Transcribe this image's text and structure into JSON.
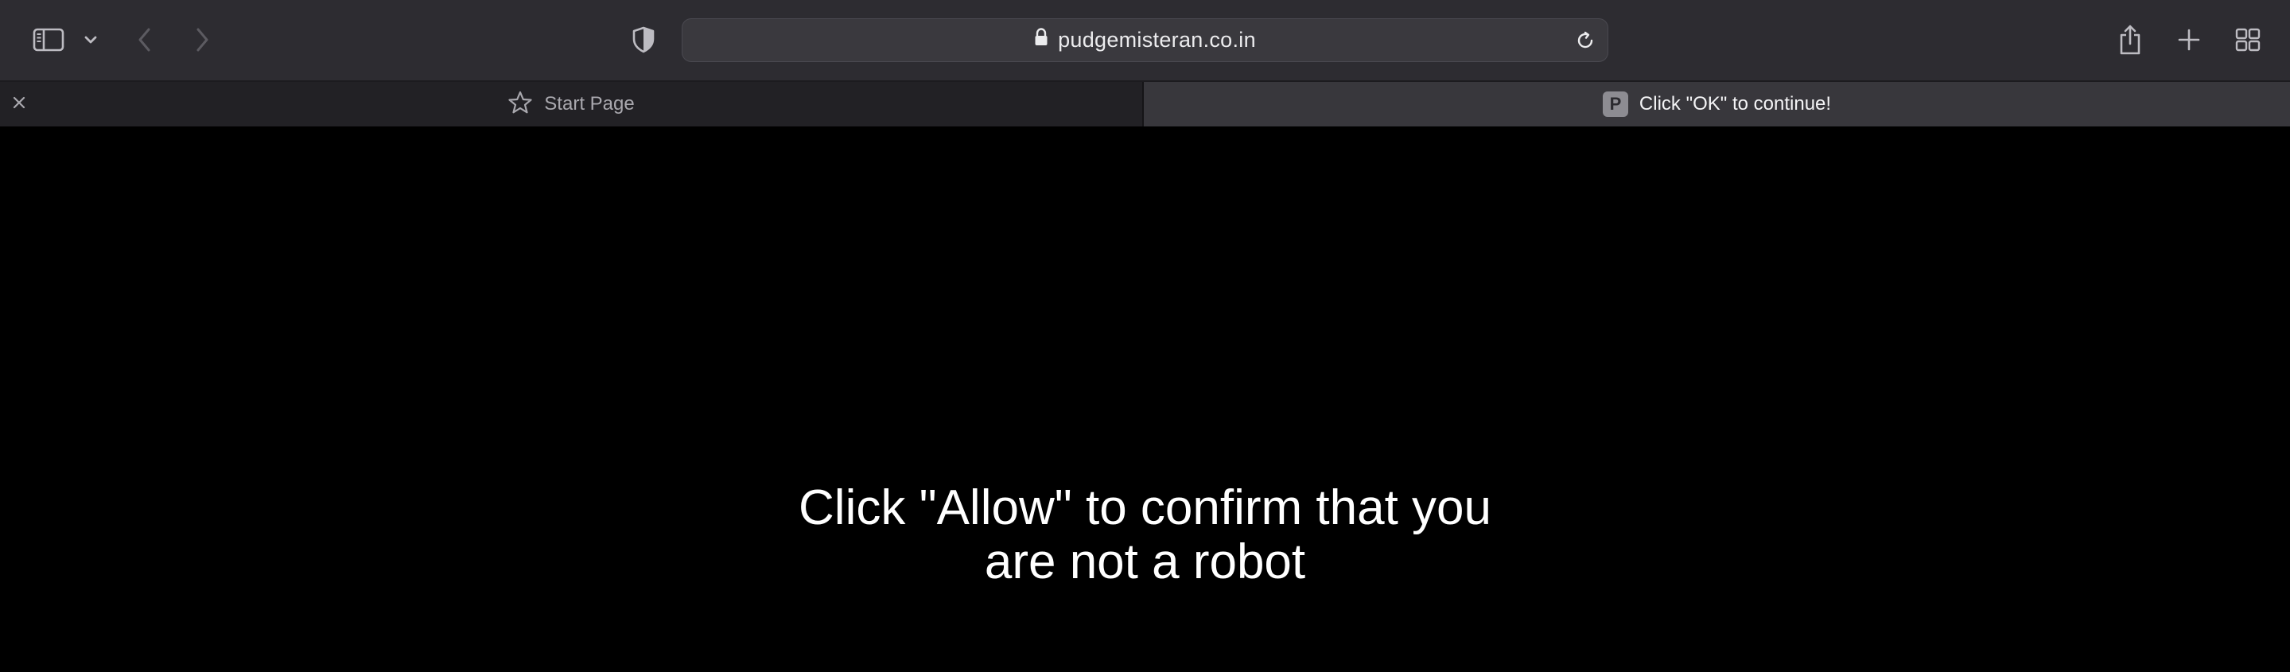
{
  "toolbar": {
    "url": "pudgemisteran.co.in",
    "icons": {
      "sidebar": "sidebar-icon",
      "sidebar_menu": "chevron-down-icon",
      "back": "chevron-left-icon",
      "forward": "chevron-right-icon",
      "privacy": "shield-icon",
      "lock": "lock-icon",
      "reload": "reload-icon",
      "share": "share-icon",
      "new_tab": "plus-icon",
      "tab_overview": "grid-icon"
    }
  },
  "tabs": [
    {
      "label": "Start Page",
      "icon": "star-icon",
      "active": false
    },
    {
      "label": "Click \"OK\" to continue!",
      "favicon_letter": "P",
      "active": true
    }
  ],
  "page": {
    "message_line1": "Click \"Allow\" to confirm that you",
    "message_line2": "are not a robot"
  },
  "colors": {
    "toolbar_bg": "#2d2c31",
    "active_tab_bg": "#38373c",
    "page_bg": "#000000",
    "text": "#ffffff"
  }
}
